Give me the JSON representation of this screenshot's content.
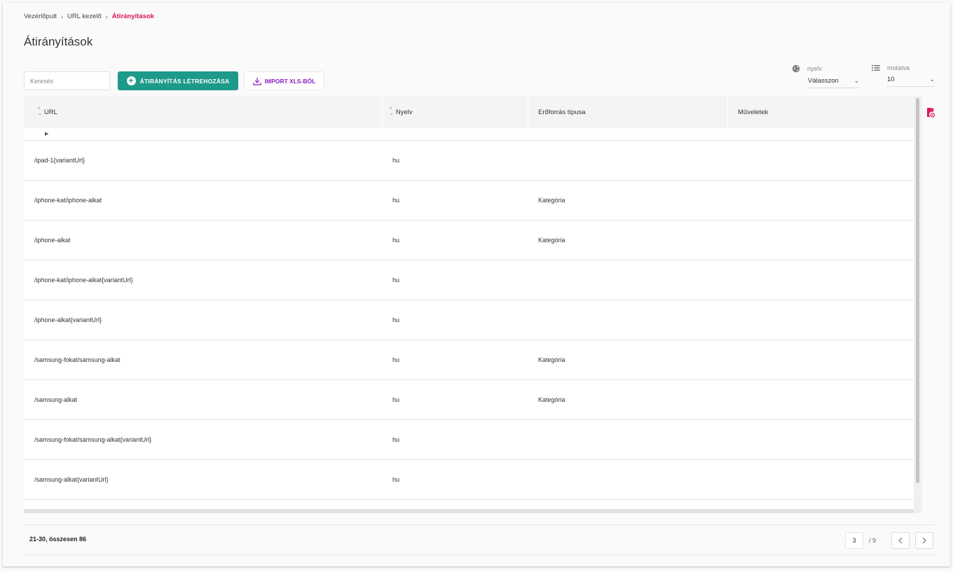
{
  "breadcrumb": {
    "items": [
      "Vezérlőpult",
      "URL kezelő"
    ],
    "current": "Átirányítások",
    "separator": "›"
  },
  "page": {
    "title": "Átirányítások"
  },
  "toolbar": {
    "search_placeholder": "Keresés",
    "create_label": "ÁTIRÁNYÍTÁS LÉTREHOZÁSA",
    "import_label": "IMPORT XLS-BŐL"
  },
  "filters": {
    "language": {
      "label": "nyelv",
      "value": "Válasszon",
      "icon": "globe-icon"
    },
    "show": {
      "label": "mutatva",
      "value": "10",
      "icon": "list-icon"
    }
  },
  "table": {
    "headers": {
      "url": "URL",
      "language": "Nyelv",
      "resource_type": "Erőforrás típusa",
      "actions": "Műveletek"
    },
    "rows": [
      {
        "url": "/ipad-1{variantUrl}",
        "lang": "hu",
        "type": ""
      },
      {
        "url": "/iphone-kat/iphone-alkat",
        "lang": "hu",
        "type": "Kategória"
      },
      {
        "url": "/iphone-alkat",
        "lang": "hu",
        "type": "Kategória"
      },
      {
        "url": "/iphone-kat/iphone-alkat{variantUrl}",
        "lang": "hu",
        "type": ""
      },
      {
        "url": "/iphone-alkat{variantUrl}",
        "lang": "hu",
        "type": ""
      },
      {
        "url": "/samsung-fokat/samsung-alkat",
        "lang": "hu",
        "type": "Kategória"
      },
      {
        "url": "/samsung-alkat",
        "lang": "hu",
        "type": "Kategória"
      },
      {
        "url": "/samsung-fokat/samsung-alkat{variantUrl}",
        "lang": "hu",
        "type": ""
      },
      {
        "url": "/samsung-alkat{variantUrl}",
        "lang": "hu",
        "type": ""
      }
    ]
  },
  "footer": {
    "count_text": "21-30, összesen 86",
    "current_page": "3",
    "total_pages": "/ 9"
  },
  "colors": {
    "accent": "#d6165f",
    "primary_button": "#1e9a8a",
    "import_text": "#8a1fc0"
  }
}
